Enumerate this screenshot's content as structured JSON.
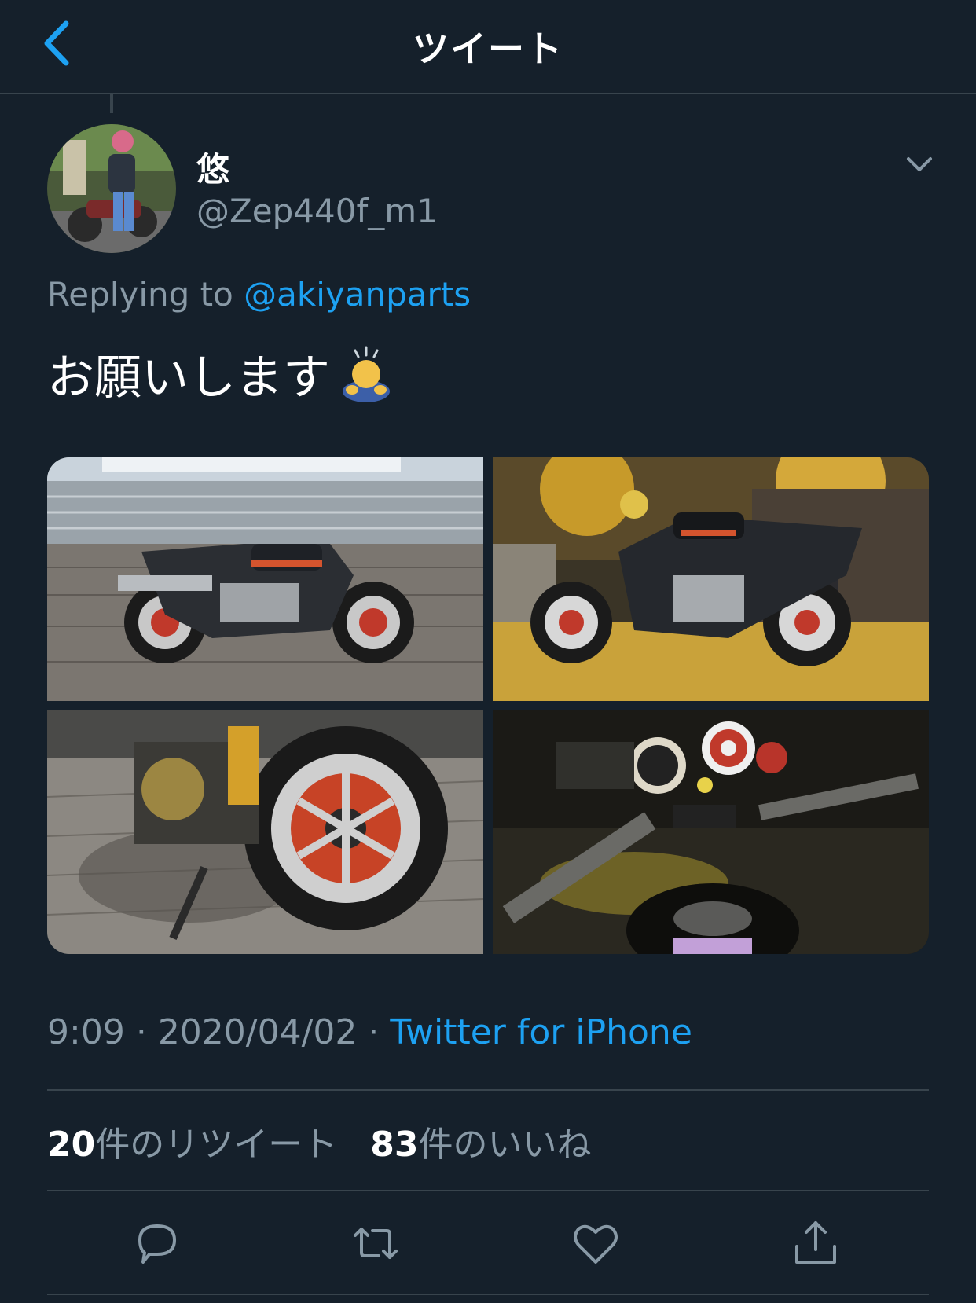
{
  "header": {
    "title": "ツイート",
    "back_icon": "chevron-left-icon"
  },
  "colors": {
    "background": "#15202b",
    "accent": "#1da1f2",
    "secondary_text": "#8899a6",
    "divider": "#38444d"
  },
  "tweet": {
    "display_name": "悠",
    "handle": "@Zep440f_m1",
    "replying_prefix": "Replying to",
    "replying_to": "@akiyanparts",
    "text": "お願いします",
    "emoji": "person-bowing-emoji",
    "photos": [
      {
        "label": "motorcycle-on-boardwalk-photo"
      },
      {
        "label": "motorcycle-autumn-leaves-photo"
      },
      {
        "label": "rear-wheel-closeup-photo"
      },
      {
        "label": "handlebar-gauges-photo"
      }
    ],
    "time": "9:09",
    "date": "2020/04/02",
    "separator": "·",
    "source": "Twitter for iPhone",
    "stats": {
      "retweets_count": "20",
      "retweets_label": "件のリツイート",
      "likes_count": "83",
      "likes_label": "件のいいね"
    }
  },
  "actions": [
    {
      "icon": "reply-icon"
    },
    {
      "icon": "retweet-icon"
    },
    {
      "icon": "like-icon"
    },
    {
      "icon": "share-icon"
    }
  ]
}
